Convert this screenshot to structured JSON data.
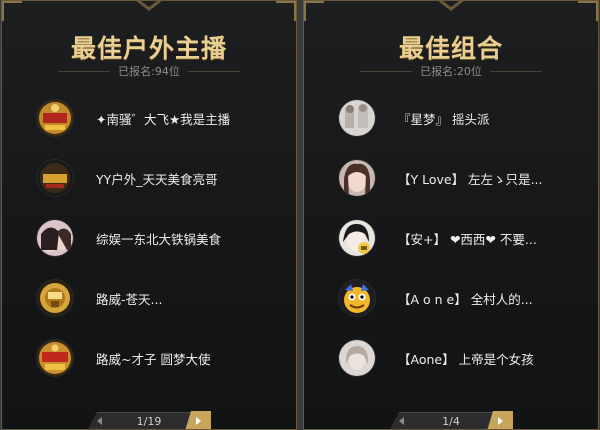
{
  "panels": [
    {
      "title": "最佳户外主播",
      "count": "已报名:94位",
      "entries": [
        {
          "name": "✦南骚゛大飞★我是主播",
          "avatar": "gold-badge"
        },
        {
          "name": "YY户外_天天美食亮哥",
          "avatar": "food-badge"
        },
        {
          "name": "综娱一东北大铁锅美食",
          "avatar": "photo-girl"
        },
        {
          "name": "路威-苍天...",
          "avatar": "gold-badge-small"
        },
        {
          "name": "路威~才子 圆梦大使",
          "avatar": "gold-badge"
        }
      ],
      "pager": "1/19"
    },
    {
      "title": "最佳组合",
      "count": "已报名:20位",
      "entries": [
        {
          "name": "『星梦』 摇头派",
          "avatar": "photo-gray"
        },
        {
          "name": "【Y Love】 左左ゝ只是...",
          "avatar": "photo-girl"
        },
        {
          "name": "【安+】 ❤西西❤ 不要...",
          "avatar": "photo-bw"
        },
        {
          "name": "【A o n e】 全村人的...",
          "avatar": "mascot"
        },
        {
          "name": "【Aone】 上帝是个女孩",
          "avatar": "photo-gray"
        }
      ],
      "pager": "1/4"
    }
  ],
  "icons": {
    "prev": "chevron-left-icon",
    "next": "chevron-right-icon"
  },
  "colors": {
    "title_gold": "#e9cf92",
    "accent_gold": "#c8a55c",
    "panel_border": "#6a5a3a"
  }
}
